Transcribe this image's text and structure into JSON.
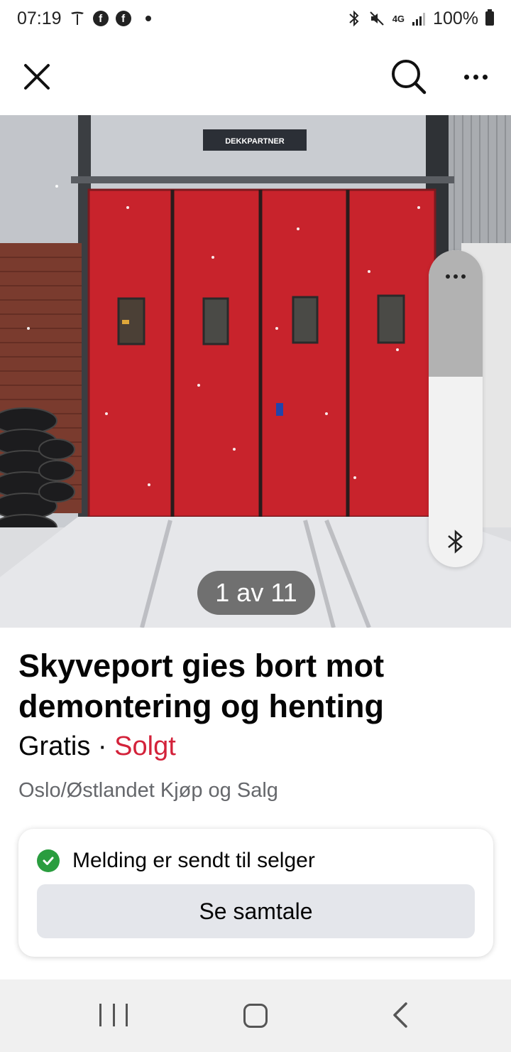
{
  "status_bar": {
    "time": "07:19",
    "battery": "100%",
    "network": "4G"
  },
  "appbar": {
    "close_icon": "close-icon",
    "search_icon": "search-icon",
    "more_icon": "more-icon"
  },
  "photo": {
    "sign_text": "DEKKPARTNER",
    "counter": "1 av 11"
  },
  "listing": {
    "title": "Skyveport gies bort mot demontering og henting",
    "price": "Gratis",
    "separator": "·",
    "status": "Solgt",
    "group": "Oslo/Østlandet Kjøp og Salg"
  },
  "message_card": {
    "status_text": "Melding er sendt til selger",
    "button_label": "Se samtale"
  },
  "colors": {
    "sold": "#d3223a",
    "check": "#2a9d3f",
    "button_bg": "#e4e6eb",
    "door_red": "#c8232c"
  }
}
